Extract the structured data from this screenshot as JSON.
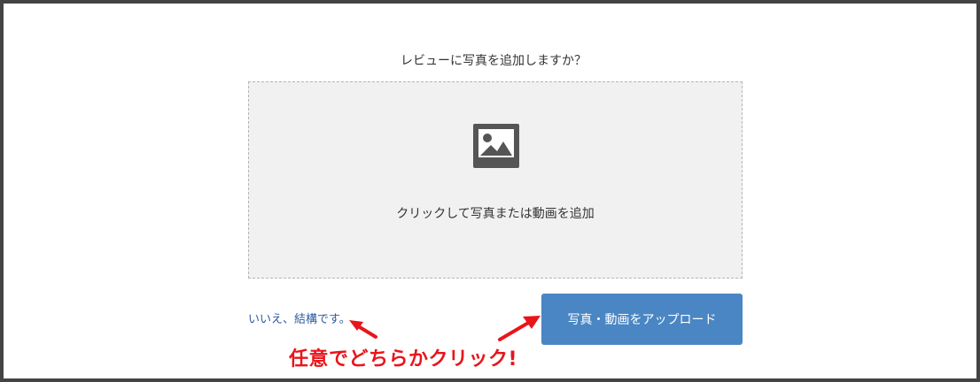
{
  "dialog": {
    "question": "レビューに写真を追加しますか？",
    "dropzone_hint": "クリックして写真または動画を追加",
    "decline_link": "いいえ、結構です。",
    "upload_button": "写真・動画をアップロード",
    "icons": {
      "dropzone": "image-placeholder-icon"
    }
  },
  "annotation": {
    "text": "任意でどちらかクリック!",
    "color": "#e8151b"
  },
  "colors": {
    "frame_border": "#444444",
    "dropzone_background": "#f1f1f1",
    "button_background": "#4a86c3",
    "link": "#2d5b9f"
  }
}
